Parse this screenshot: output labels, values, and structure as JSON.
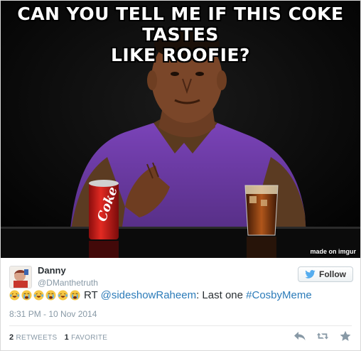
{
  "meme": {
    "caption_line1": "CAN YOU TELL ME IF THIS COKE TASTES",
    "caption_line2": "LIKE ROOFIE?",
    "watermark": "made on imgur",
    "can_text": "Coke"
  },
  "tweet": {
    "name": "Danny",
    "handle": "@DManthetruth",
    "follow_label": "Follow",
    "emojis": [
      "laughing-crying-emoji",
      "crying-emoji",
      "laughing-crying-emoji",
      "crying-emoji",
      "laughing-crying-emoji",
      "crying-emoji"
    ],
    "rt_prefix": "RT ",
    "mention": "@sideshowRaheem",
    "text_middle": ": Last one ",
    "hashtag": "#CosbyMeme",
    "timestamp": "8:31 PM - 10 Nov 2014",
    "retweets_count": "2",
    "retweets_label": "RETWEETS",
    "favorites_count": "1",
    "favorites_label": "FAVORITE"
  },
  "colors": {
    "link": "#2b7bb9",
    "text": "#292f33",
    "muted": "#8899a6",
    "twitter_blue": "#55acee"
  }
}
